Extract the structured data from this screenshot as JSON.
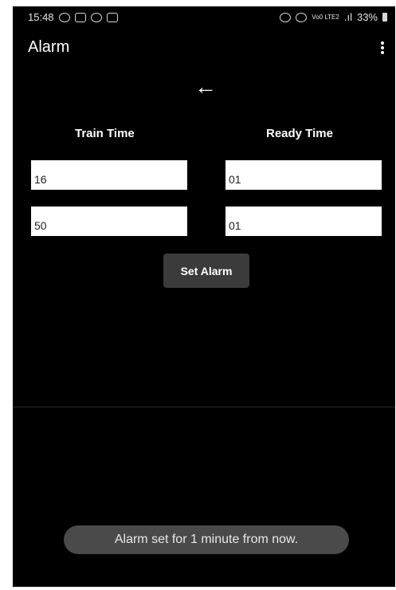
{
  "status_bar": {
    "time": "15:48",
    "icons_left": [
      "whatsapp-icon",
      "instagram-icon",
      "missed-call-icon",
      "image-icon"
    ],
    "icons_right": [
      "alarm-icon",
      "wifi-icon",
      "volte-icon",
      "signal-icon",
      "battery-icon"
    ],
    "volte_label": "Vo0 LTE2",
    "battery": "33%"
  },
  "appbar": {
    "title": "Alarm",
    "menu_icon": "more-vert-icon"
  },
  "back_icon": "arrow-back-icon",
  "back_glyph": "←",
  "columns": {
    "train_label": "Train Time",
    "ready_label": "Ready Time"
  },
  "fields": {
    "train_hour": "16",
    "train_minute": "50",
    "ready_hour": "01",
    "ready_minute": "01"
  },
  "set_button": "Set Alarm",
  "toast": "Alarm set for 1 minute from now.",
  "colors": {
    "background": "#000000",
    "field": "#ffffff",
    "button": "#3b3b3b",
    "toast": "#4a4a4a"
  }
}
